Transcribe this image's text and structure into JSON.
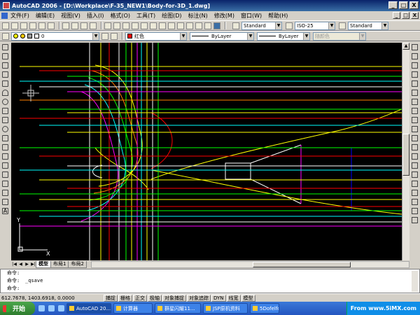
{
  "window": {
    "title": "AutoCAD 2006 - [D:\\Workplace\\F-35_NEW1\\Body-for-3D_1.dwg]",
    "controls": [
      "_",
      "□",
      "X"
    ]
  },
  "menubar": {
    "items": [
      "文件(F)",
      "编辑(E)",
      "视图(V)",
      "插入(I)",
      "格式(O)",
      "工具(T)",
      "绘图(D)",
      "标注(N)",
      "修改(M)",
      "窗口(W)",
      "帮助(H)"
    ],
    "doc_controls": [
      "_",
      "□",
      "X"
    ]
  },
  "toolbar1": {
    "text_style": "Standard",
    "dim_style": "ISO-25",
    "table_style": "Standard"
  },
  "toolbar2": {
    "layer": "0",
    "color": "红色",
    "color_hex": "#ff0000",
    "linetype": "ByLayer",
    "lineweight": "ByLayer",
    "plotstyle": "随颜色"
  },
  "ucs": {
    "x_label": "X",
    "y_label": "Y"
  },
  "tabs": {
    "nav": [
      "|◀",
      "◀",
      "▶",
      "▶|"
    ],
    "items": [
      "模型",
      "布局1",
      "布局2"
    ]
  },
  "command": {
    "lines": [
      {
        "prompt": "命令:",
        "text": ""
      },
      {
        "prompt": "命令:",
        "text": "_qsave"
      },
      {
        "prompt": "命令:",
        "text": ""
      }
    ]
  },
  "status": {
    "coords": "612.7678, 1403.6918, 0.0000",
    "buttons": [
      "捕捉",
      "栅格",
      "正交",
      "极轴",
      "对象捕捉",
      "对象追踪",
      "DYN",
      "线宽",
      "模型"
    ]
  },
  "taskbar": {
    "start": "开始",
    "tasks": [
      "AutoCAD 20...",
      "计算器",
      "群星闪耀11...",
      "JSP原机资料",
      "5Dofelfor..."
    ],
    "tray": "From www.5iMX.com"
  },
  "colors": {
    "canvas": "#000000",
    "titlebar": "#0a246a",
    "taskbar": "#2456c0"
  }
}
